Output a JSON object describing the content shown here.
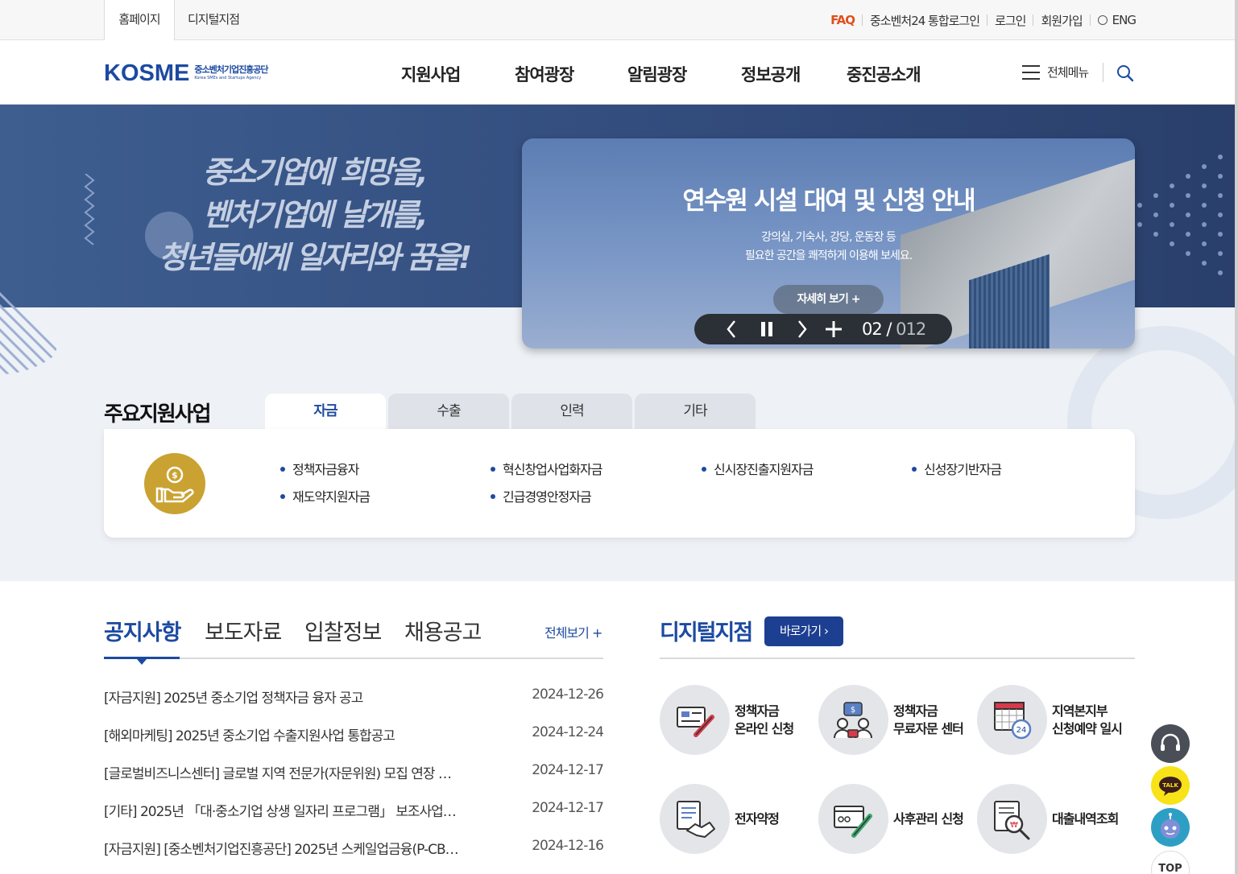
{
  "util": {
    "tab_home": "홈페이지",
    "tab_digital": "디지털지점",
    "faq": "FAQ",
    "integrated_login": "중소벤처24 통합로그인",
    "login": "로그인",
    "signup": "회원가입",
    "lang": "ENG"
  },
  "header": {
    "logo_mark": "KOSME",
    "logo_ko": "중소벤처기업진흥공단",
    "logo_en": "Korea SMEs and Startups Agency",
    "nav": [
      "지원사업",
      "참여광장",
      "알림광장",
      "정보공개",
      "중진공소개"
    ],
    "all_menu": "전체메뉴"
  },
  "hero": {
    "slogan_1": "중소기업에 희망을,",
    "slogan_2": "벤처기업에 날개를,",
    "slogan_3": "청년들에게 일자리와 꿈을!",
    "slide_title": "연수원 시설 대여 및 신청 안내",
    "slide_desc_1": "강의실, 기숙사, 강당, 운동장 등",
    "slide_desc_2": "필요한 공간을 쾌적하게 이용해 보세요.",
    "slide_more": "자세히 보기",
    "slide_current": "02",
    "slide_total": "012"
  },
  "support": {
    "title": "주요지원사업",
    "tabs": [
      "자금",
      "수출",
      "인력",
      "기타"
    ],
    "items": [
      "정책자금융자",
      "혁신창업사업화자금",
      "신시장진출지원자금",
      "신성장기반자금",
      "재도약지원자금",
      "긴급경영안정자금"
    ]
  },
  "notice": {
    "tabs": [
      "공지사항",
      "보도자료",
      "입찰정보",
      "채용공고"
    ],
    "view_all": "전체보기 +",
    "rows": [
      {
        "title": "[자금지원] 2025년 중소기업 정책자금 융자 공고",
        "date": "2024-12-26"
      },
      {
        "title": "[해외마케팅] 2025년 중소기업 수출지원사업 통합공고",
        "date": "2024-12-24"
      },
      {
        "title": "[글로벌비즈니스센터] 글로벌 지역 전문가(자문위원) 모집 연장 …",
        "date": "2024-12-17"
      },
      {
        "title": "[기타] 2025년 「대·중소기업 상생 일자리 프로그램」 보조사업자 …",
        "date": "2024-12-17"
      },
      {
        "title": "[자금지원] [중소벤처기업진흥공단] 2025년 스케일업금융(P-CB…",
        "date": "2024-12-16"
      }
    ]
  },
  "digital": {
    "title": "디지털지점",
    "go": "바로가기",
    "services": [
      {
        "line1": "정책자금",
        "line2": "온라인 신청",
        "icon": "online-apply-icon"
      },
      {
        "line1": "정책자금",
        "line2": "무료자문 센터",
        "icon": "consult-icon"
      },
      {
        "line1": "지역본지부",
        "line2": "신청예약 일시",
        "icon": "calendar-24-icon"
      },
      {
        "line1": "전자약정",
        "line2": "",
        "icon": "contract-icon"
      },
      {
        "line1": "사후관리 신청",
        "line2": "",
        "icon": "aftercare-icon"
      },
      {
        "line1": "대출내역조회",
        "line2": "",
        "icon": "loan-search-icon"
      }
    ]
  },
  "floating": {
    "talk": "TALK",
    "top": "TOP"
  },
  "colors": {
    "brand_blue": "#1c4aa0",
    "faq_orange": "#e0501e",
    "hero_navy": "#344f80",
    "coin_gold": "#c9a232"
  }
}
